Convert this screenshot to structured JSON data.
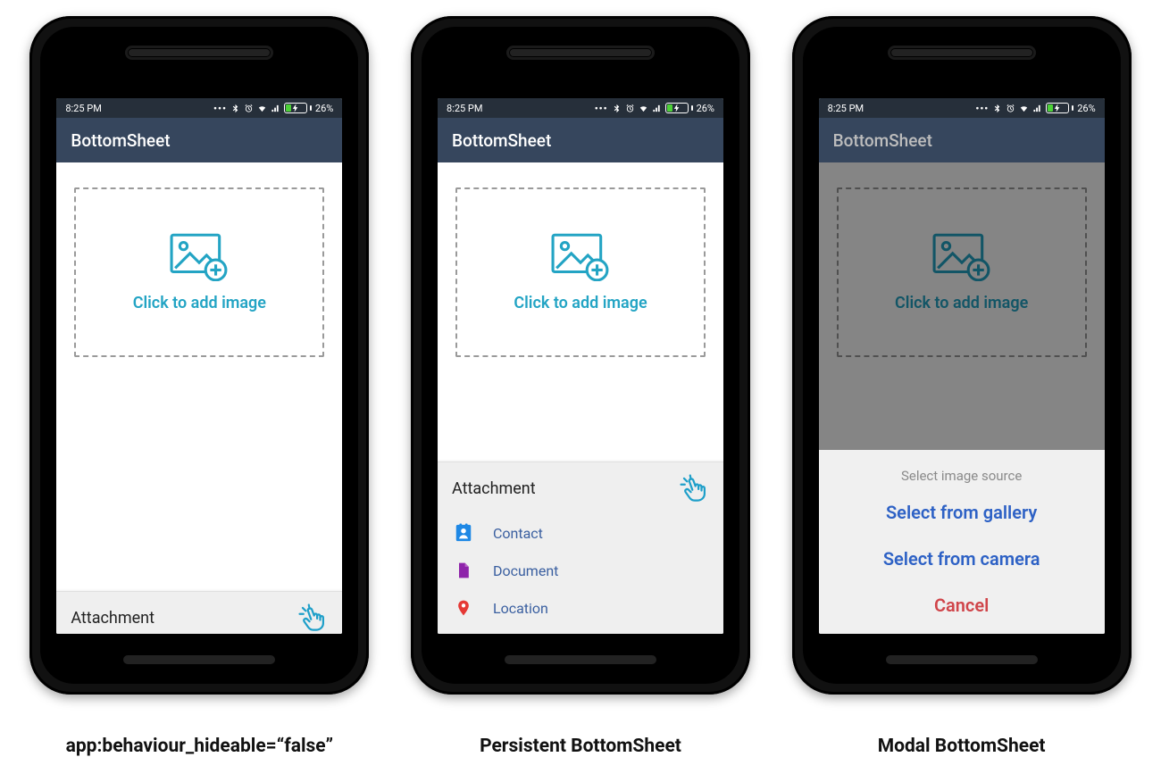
{
  "status": {
    "time": "8:25 PM",
    "battery_pct": "26%"
  },
  "app": {
    "title": "BottomSheet"
  },
  "add_image": {
    "label": "Click to add image"
  },
  "attachment": {
    "header": "Attachment",
    "items": [
      {
        "label": "Contact",
        "icon": "contact"
      },
      {
        "label": "Document",
        "icon": "document"
      },
      {
        "label": "Location",
        "icon": "location"
      }
    ]
  },
  "modal": {
    "title": "Select image source",
    "gallery": "Select from gallery",
    "camera": "Select from camera",
    "cancel": "Cancel"
  },
  "captions": {
    "left": "app:behaviour_hideable=“false”",
    "center": "Persistent BottomSheet",
    "right": "Modal BottomSheet"
  },
  "colors": {
    "accent": "#23a4c4",
    "appbar": "#36465d",
    "statusbar": "#262f3a",
    "link": "#2d61c5",
    "danger": "#d0454a"
  }
}
